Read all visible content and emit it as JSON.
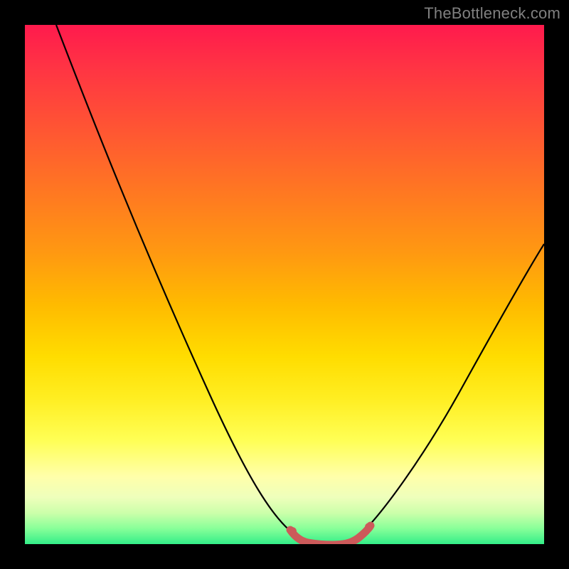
{
  "watermark": {
    "text": "TheBottleneck.com"
  },
  "gradient_colors": {
    "top": "#ff1a4d",
    "mid_upper": "#ff7722",
    "mid": "#ffdd00",
    "mid_lower": "#ffffaa",
    "bottom": "#33ee88"
  },
  "curve_colors": {
    "main": "#000000",
    "highlight": "#cc5a5a"
  },
  "chart_data": {
    "type": "line",
    "title": "",
    "xlabel": "",
    "ylabel": "",
    "xlim": [
      0,
      100
    ],
    "ylim": [
      0,
      100
    ],
    "grid": false,
    "legend": false,
    "series": [
      {
        "name": "bottleneck-curve",
        "x": [
          6,
          10,
          15,
          20,
          25,
          30,
          35,
          40,
          45,
          50,
          53,
          56,
          60,
          64,
          70,
          76,
          82,
          88,
          94,
          100
        ],
        "y": [
          100,
          92,
          82,
          72,
          62,
          52,
          42,
          32,
          22,
          12,
          6,
          3,
          2,
          3,
          8,
          16,
          26,
          36,
          46,
          56
        ]
      },
      {
        "name": "optimal-band",
        "x": [
          53,
          56,
          60,
          64
        ],
        "y": [
          6,
          3,
          2,
          3
        ]
      }
    ],
    "annotations": []
  }
}
